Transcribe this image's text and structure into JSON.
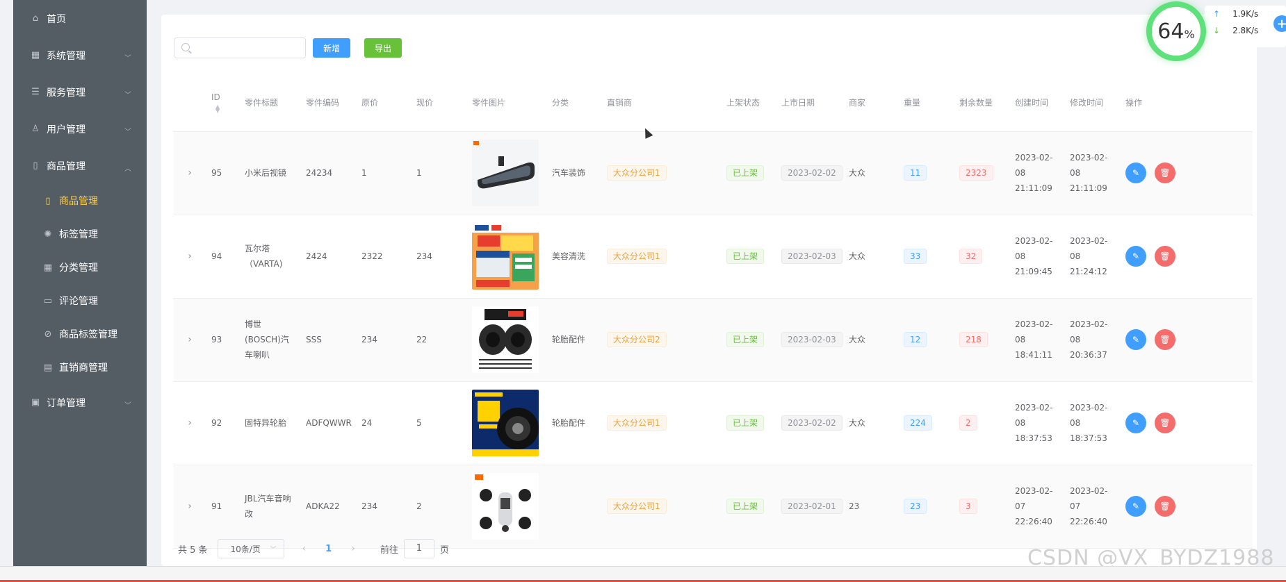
{
  "sidebar": {
    "items": [
      {
        "label": "首页",
        "icon": "home-icon"
      },
      {
        "label": "系统管理",
        "icon": "grid-icon"
      },
      {
        "label": "服务管理",
        "icon": "database-icon"
      },
      {
        "label": "用户管理",
        "icon": "user-icon"
      },
      {
        "label": "商品管理",
        "icon": "book-icon"
      }
    ],
    "sub_items": [
      {
        "label": "商品管理",
        "icon": "book-icon"
      },
      {
        "label": "标签管理",
        "icon": "loading-icon"
      },
      {
        "label": "分类管理",
        "icon": "menu-icon"
      },
      {
        "label": "评论管理",
        "icon": "comment-icon"
      },
      {
        "label": "商品标签管理",
        "icon": "tag-icon"
      },
      {
        "label": "直销商管理",
        "icon": "office-icon"
      }
    ],
    "last_item": {
      "label": "订单管理",
      "icon": "document-icon"
    }
  },
  "toolbar": {
    "search_placeholder": "",
    "add_label": "新增",
    "export_label": "导出"
  },
  "table": {
    "headers": [
      "ID",
      "零件标题",
      "零件编码",
      "原价",
      "现价",
      "零件图片",
      "分类",
      "直销商",
      "上架状态",
      "上市日期",
      "商家",
      "重量",
      "剩余数量",
      "创建时间",
      "修改时间",
      "操作"
    ],
    "rows": [
      {
        "id": "95",
        "title": "小米后视镜",
        "code": "24234",
        "orig": "1",
        "price": "1",
        "category": "汽车装饰",
        "dealer": "大众分公司1",
        "status": "已上架",
        "date": "2023-02-02",
        "merchant": "大众",
        "weight": "11",
        "stock": "2323",
        "created": "2023-02-08 21:11:09",
        "modified": "2023-02-08 21:11:09"
      },
      {
        "id": "94",
        "title": "瓦尔塔（VARTA)",
        "code": "2424",
        "orig": "2322",
        "price": "234",
        "category": "美容清洗",
        "dealer": "大众分公司1",
        "status": "已上架",
        "date": "2023-02-03",
        "merchant": "大众",
        "weight": "33",
        "stock": "32",
        "created": "2023-02-08 21:09:45",
        "modified": "2023-02-08 21:24:12"
      },
      {
        "id": "93",
        "title": "博世(BOSCH)汽车喇叭",
        "code": "SSS",
        "orig": "234",
        "price": "22",
        "category": "轮胎配件",
        "dealer": "大众分公司2",
        "status": "已上架",
        "date": "2023-02-03",
        "merchant": "大众",
        "weight": "12",
        "stock": "218",
        "created": "2023-02-08 18:41:11",
        "modified": "2023-02-08 20:36:37"
      },
      {
        "id": "92",
        "title": "固特异轮胎",
        "code": "ADFQWWR",
        "orig": "24",
        "price": "5",
        "category": "轮胎配件",
        "dealer": "大众分公司1",
        "status": "已上架",
        "date": "2023-02-02",
        "merchant": "大众",
        "weight": "224",
        "stock": "2",
        "created": "2023-02-08 18:37:53",
        "modified": "2023-02-08 18:37:53"
      },
      {
        "id": "91",
        "title": "JBL汽车音响改",
        "code": "ADKA22",
        "orig": "234",
        "price": "2",
        "category": "",
        "dealer": "大众分公司1",
        "status": "已上架",
        "date": "2023-02-01",
        "merchant": "23",
        "weight": "23",
        "stock": "3",
        "created": "2023-02-07 22:26:40",
        "modified": "2023-02-07 22:26:40"
      }
    ]
  },
  "pager": {
    "total": "共 5 条",
    "page_size": "10条/页",
    "current": "1",
    "goto_prefix": "前往",
    "goto_value": "1",
    "goto_suffix": "页"
  },
  "speed": {
    "percent": "64",
    "percent_unit": "%",
    "up": "1.9K/s",
    "down": "2.8K/s"
  },
  "watermark": "CSDN @VX_BYDZ1988",
  "colors": {
    "sidebar": "#545c64",
    "active": "#ffd04b",
    "primary": "#409eff",
    "success": "#67c23a",
    "danger": "#f56c6c"
  }
}
